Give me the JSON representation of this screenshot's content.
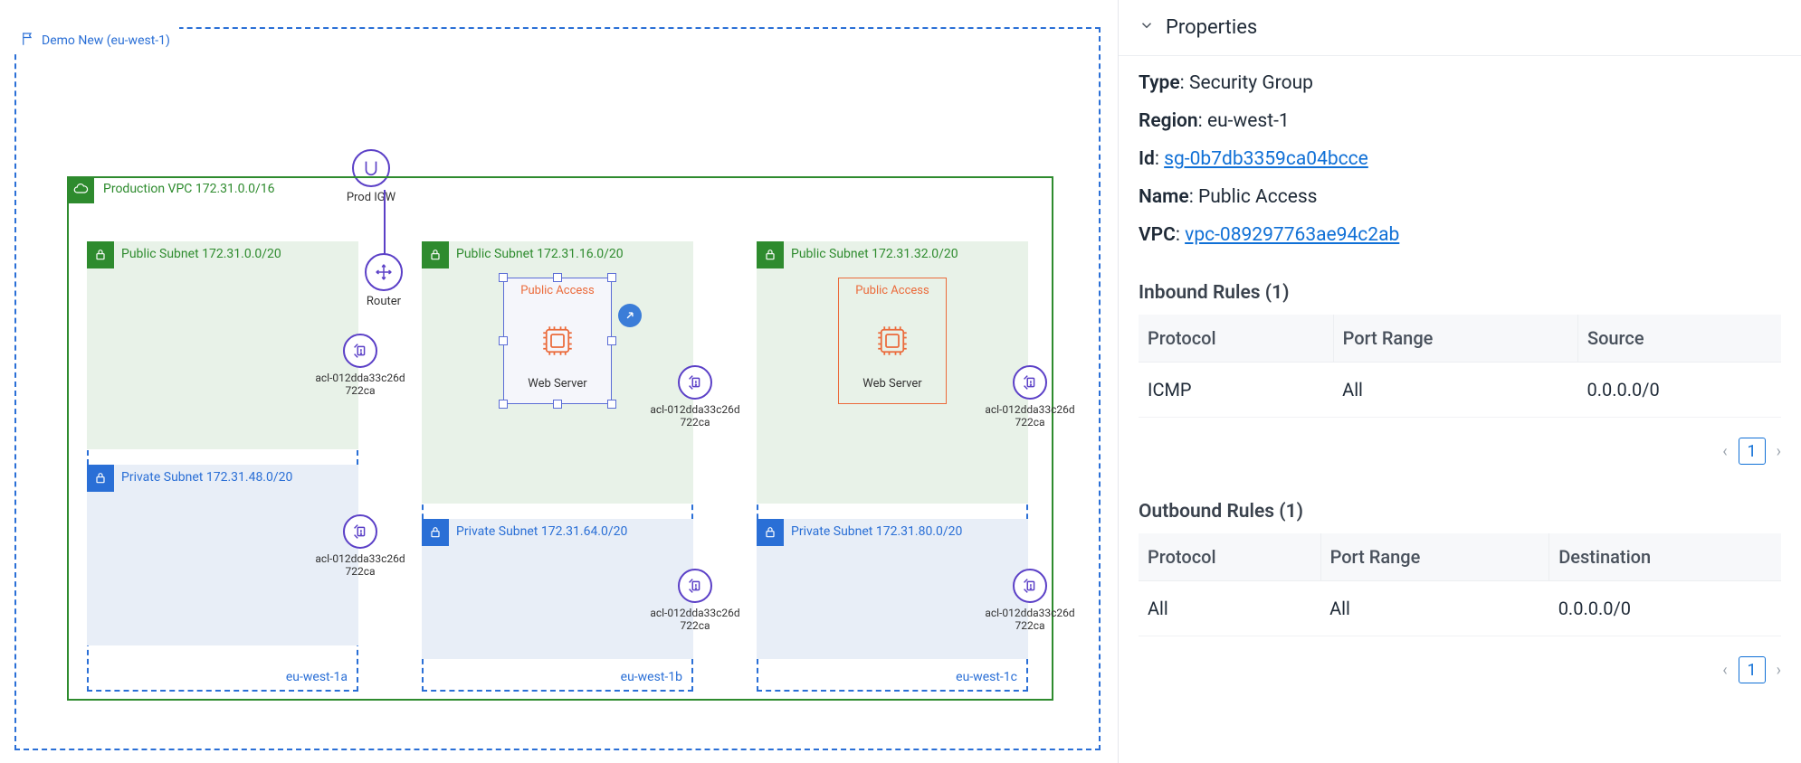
{
  "region_box": {
    "label": "Demo New (eu-west-1)"
  },
  "vpc_box": {
    "label": "Production VPC 172.31.0.0/16"
  },
  "igw": {
    "label": "Prod IGW"
  },
  "router": {
    "label": "Router"
  },
  "azs": [
    {
      "label": "eu-west-1a",
      "public": {
        "label": "Public Subnet 172.31.0.0/20"
      },
      "private": {
        "label": "Private Subnet 172.31.48.0/20"
      },
      "nacls": [
        {
          "label": "acl-012dda33c26d722ca"
        },
        {
          "label": "acl-012dda33c26d722ca"
        }
      ]
    },
    {
      "label": "eu-west-1b",
      "public": {
        "label": "Public Subnet 172.31.16.0/20"
      },
      "private": {
        "label": "Private Subnet 172.31.64.0/20"
      },
      "nacls": [
        {
          "label": "acl-012dda33c26d722ca"
        },
        {
          "label": "acl-012dda33c26d722ca"
        }
      ]
    },
    {
      "label": "eu-west-1c",
      "public": {
        "label": "Public Subnet 172.31.32.0/20"
      },
      "private": {
        "label": "Private Subnet 172.31.80.0/20"
      },
      "nacls": [
        {
          "label": "acl-012dda33c26d722ca"
        },
        {
          "label": "acl-012dda33c26d722ca"
        }
      ]
    }
  ],
  "sg_box": {
    "name": "Public Access",
    "server_label": "Web Server"
  },
  "props": {
    "title": "Properties",
    "type_key": "Type",
    "type_val": "Security Group",
    "region_key": "Region",
    "region_val": "eu-west-1",
    "id_key": "Id",
    "id_val": "sg-0b7db3359ca04bcce",
    "name_key": "Name",
    "name_val": "Public Access",
    "vpc_key": "VPC",
    "vpc_val": "vpc-089297763ae94c2ab",
    "inbound_heading": "Inbound Rules (1)",
    "outbound_heading": "Outbound Rules (1)",
    "cols_in": [
      "Protocol",
      "Port Range",
      "Source"
    ],
    "cols_out": [
      "Protocol",
      "Port Range",
      "Destination"
    ],
    "rows_in": [
      [
        "ICMP",
        "All",
        "0.0.0.0/0"
      ]
    ],
    "rows_out": [
      [
        "All",
        "All",
        "0.0.0.0/0"
      ]
    ],
    "page_num": "1"
  },
  "colors": {
    "blue": "#2a6fd6",
    "green": "#2e8b2e",
    "orange": "#eb6a3a",
    "purple": "#5b40c7",
    "link": "#1070d6"
  }
}
